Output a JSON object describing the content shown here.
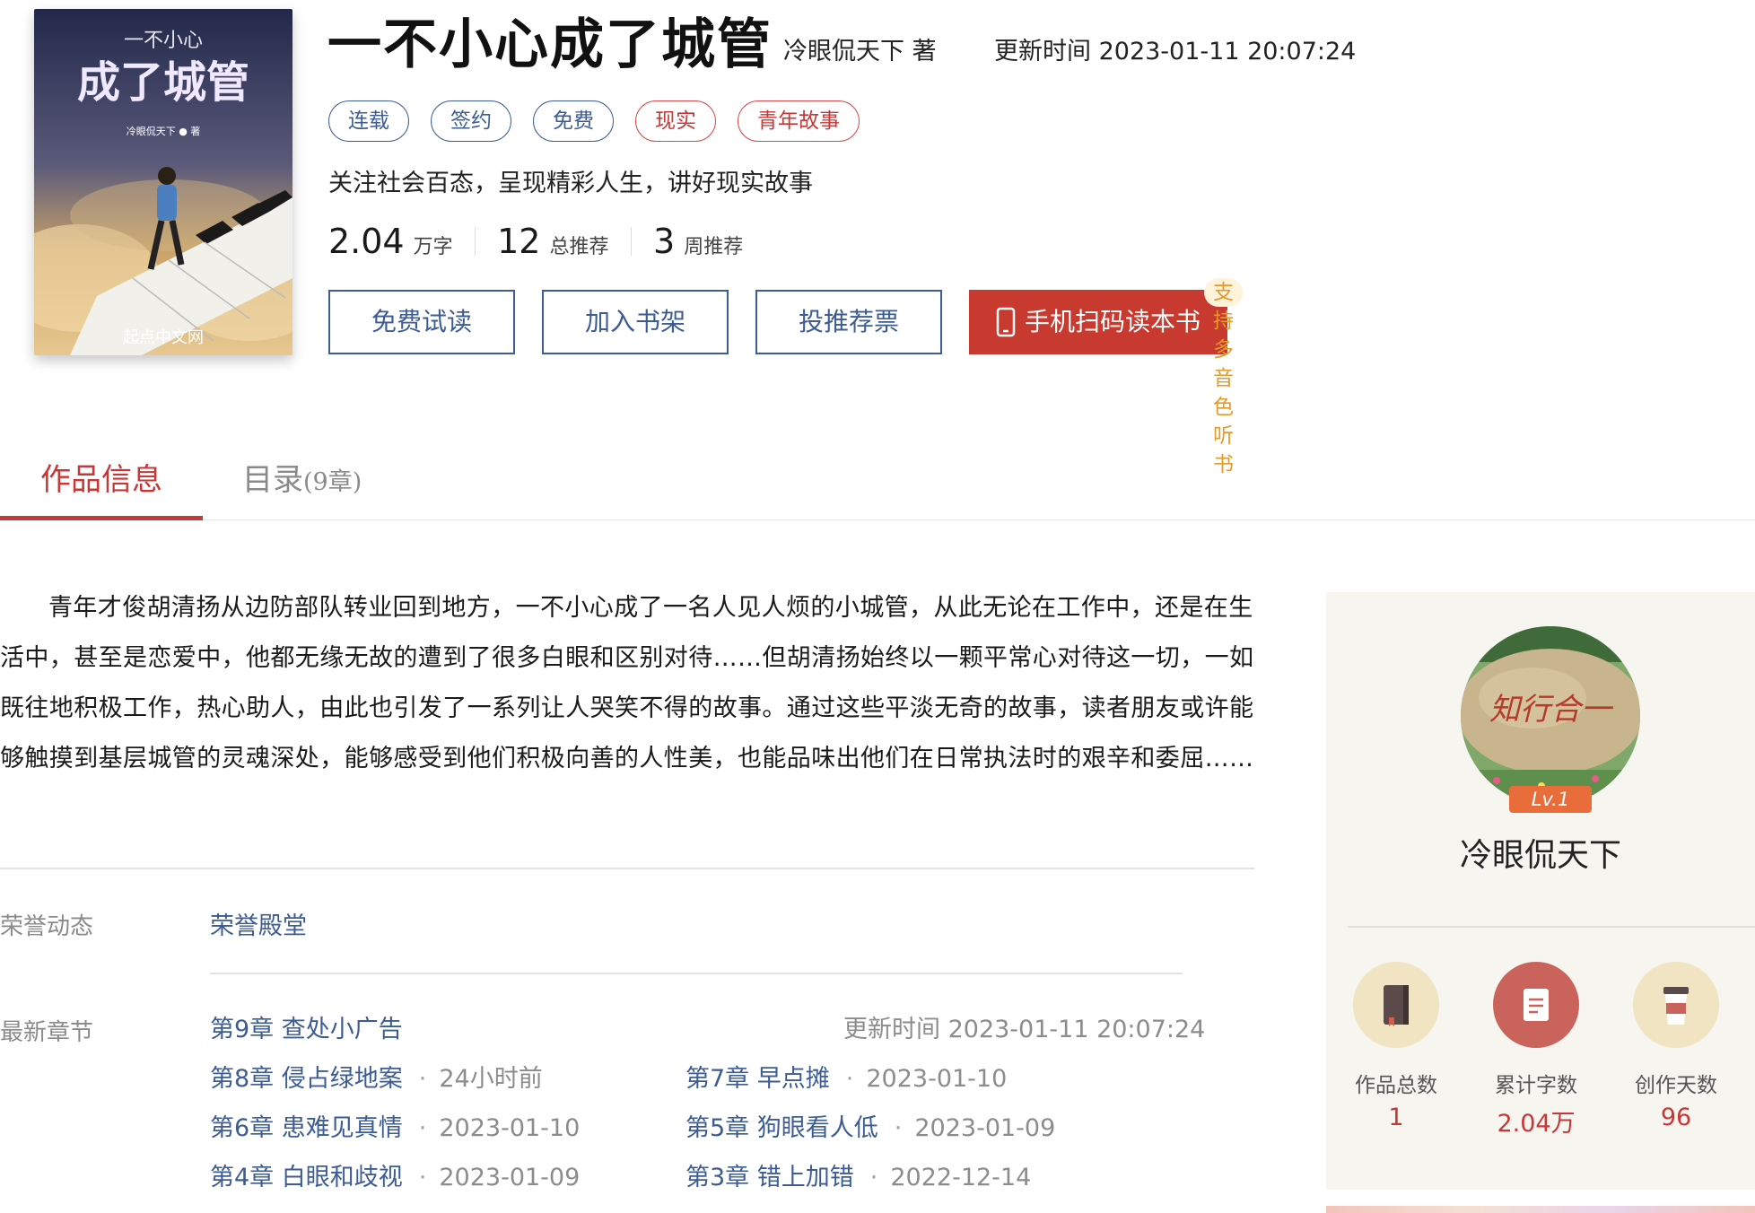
{
  "book": {
    "cover_title_small": "一不小心",
    "cover_title_large": "成了城管",
    "cover_author": "冷眼侃天下 ● 著",
    "cover_site": "起点中文网",
    "title": "一不小心成了城管",
    "author_line": "冷眼侃天下 著",
    "update_time": "更新时间 2023-01-11 20:07:24",
    "tags": [
      {
        "label": "连载",
        "color": "#3d5c94"
      },
      {
        "label": "签约",
        "color": "#3d5c94"
      },
      {
        "label": "免费",
        "color": "#3d5c94"
      },
      {
        "label": "现实",
        "color": "#c83737"
      },
      {
        "label": "青年故事",
        "color": "#c83737"
      }
    ],
    "intro": "关注社会百态，呈现精彩人生，讲好现实故事",
    "stats": [
      {
        "value": "2.04",
        "unit": "万字"
      },
      {
        "value": "12",
        "unit": "总推荐"
      },
      {
        "value": "3",
        "unit": "周推荐"
      }
    ]
  },
  "actions": {
    "free_read": "免费试读",
    "add_shelf": "加入书架",
    "vote": "投推荐票",
    "scan": "手机扫码读本书",
    "audio_badge": "支持多音色听书"
  },
  "tabs": {
    "info": "作品信息",
    "toc": "目录",
    "toc_count": "(9章)"
  },
  "description": "青年才俊胡清扬从边防部队转业回到地方，一不小心成了一名人见人烦的小城管，从此无论在工作中，还是在生活中，甚至是恋爱中，他都无缘无故的遭到了很多白眼和区别对待……但胡清扬始终以一颗平常心对待这一切，一如既往地积极工作，热心助人，由此也引发了一系列让人哭笑不得的故事。通过这些平淡无奇的故事，读者朋友或许能够触摸到基层城管的灵魂深处，能够感受到他们积极向善的人性美，也能品味出他们在日常执法时的艰辛和委屈……",
  "honor": {
    "label": "荣誉动态",
    "link": "荣誉殿堂"
  },
  "latest": {
    "label": "最新章节",
    "first_chapter": "第9章 查处小广告",
    "first_time": "更新时间 2023-01-11 20:07:24",
    "chapters": [
      {
        "title": "第8章 侵占绿地案",
        "time": "24小时前"
      },
      {
        "title": "第7章 早点摊",
        "time": "2023-01-10"
      },
      {
        "title": "第6章 患难见真情",
        "time": "2023-01-10"
      },
      {
        "title": "第5章 狗眼看人低",
        "time": "2023-01-09"
      },
      {
        "title": "第4章 白眼和歧视",
        "time": "2023-01-09"
      },
      {
        "title": "第3章 错上加错",
        "time": "2022-12-14"
      }
    ],
    "separator": "·"
  },
  "author_card": {
    "avatar_text": "知行合一",
    "level": "Lv.1",
    "name": "冷眼侃天下",
    "stats": [
      {
        "label": "作品总数",
        "value": "1",
        "icon": "book-icon",
        "bg": "#f1e4c3"
      },
      {
        "label": "累计字数",
        "value": "2.04万",
        "icon": "document-icon",
        "bg": "#c9635c"
      },
      {
        "label": "创作天数",
        "value": "96",
        "icon": "coffee-cup-icon",
        "bg": "#f1e4c3"
      }
    ]
  },
  "colors": {
    "accent_red": "#c83737",
    "link_blue": "#3d5c94",
    "scan_button": "#c8392f"
  }
}
